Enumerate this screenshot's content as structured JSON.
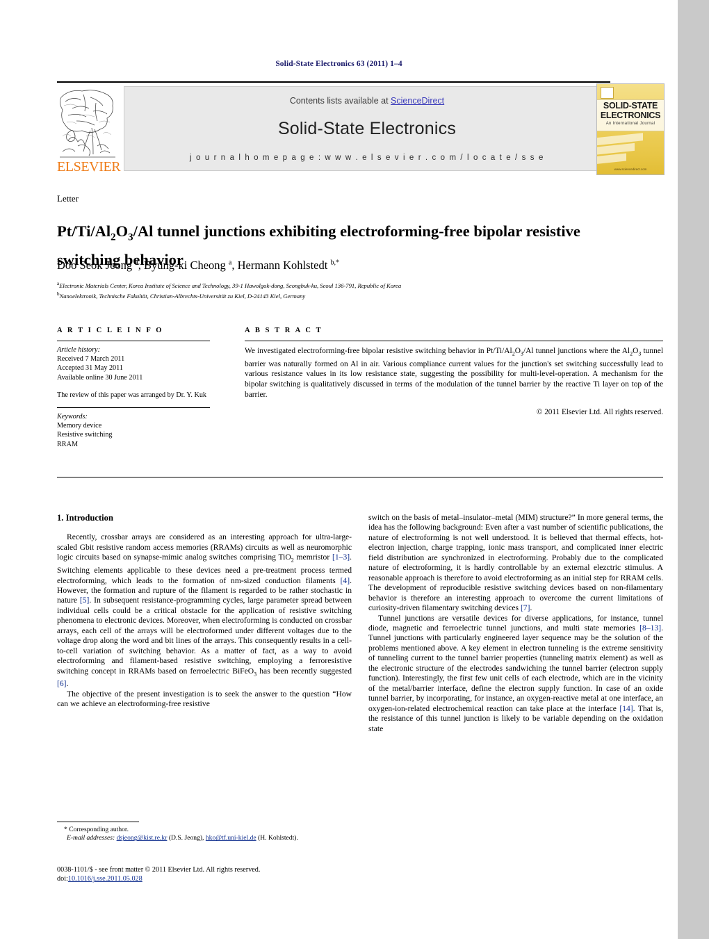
{
  "running_head": "Solid-State Electronics 63 (2011) 1–4",
  "masthead": {
    "contents_prefix": "Contents lists available at ",
    "sciencedirect": "ScienceDirect",
    "journal_name": "Solid-State Electronics",
    "homepage": "j o u r n a l   h o m e p a g e :   w w w . e l s e v i e r . c o m / l o c a t e / s s e",
    "publisher_logo_text": "ELSEVIER",
    "publisher_logo_icon": "elsevier-tree-icon"
  },
  "cover": {
    "title_line1": "SOLID-STATE",
    "title_line2": "ELECTRONICS",
    "subtitle": "An International Journal",
    "footer": "Available online at\nScienceDirect\nwww.sciencedirect.com"
  },
  "article": {
    "type_label": "Letter",
    "title_html": "Pt/Ti/Al<sub>2</sub>O<sub>3</sub>/Al tunnel junctions exhibiting electroforming-free bipolar resistive switching behavior",
    "authors_html": "Doo Seok Jeong <sup>a</sup>, Byung-ki Cheong <sup>a</sup>, Hermann Kohlstedt <sup>b,</sup><sup>*</sup>",
    "affiliations": [
      "Electronic Materials Center, Korea Institute of Science and Technology, 39-1 Hawolgok-dong, Seongbuk-ku, Seoul 136-791, Republic of Korea",
      "Nanoelektronik, Technische Fakultät, Christian-Albrechts-Universität zu Kiel, D-24143 Kiel, Germany"
    ],
    "affiliation_marks": [
      "a",
      "b"
    ]
  },
  "article_info": {
    "heading": "A R T I C L E  I N F O",
    "history_label": "Article history:",
    "history": [
      "Received 7 March 2011",
      "Accepted 31 May 2011",
      "Available online 30 June 2011"
    ],
    "review_note": "The review of this paper was arranged by Dr. Y. Kuk",
    "keywords_label": "Keywords:",
    "keywords": [
      "Memory device",
      "Resistive switching",
      "RRAM"
    ]
  },
  "abstract": {
    "heading": "A B S T R A C T",
    "text_html": "We investigated electroforming-free bipolar resistive switching behavior in Pt/Ti/Al<sub>2</sub>O<sub>3</sub>/Al tunnel junctions where the Al<sub>2</sub>O<sub>3</sub> tunnel barrier was naturally formed on Al in air. Various compliance current values for the junction's set switching successfully lead to various resistance values in its low resistance state, suggesting the possibility for multi-level-operation. A mechanism for the bipolar switching is qualitatively discussed in terms of the modulation of the tunnel barrier by the reactive Ti layer on top of the barrier.",
    "copyright": "© 2011 Elsevier Ltd. All rights reserved."
  },
  "body": {
    "section1_heading": "1. Introduction",
    "left_paragraphs": [
      "Recently, crossbar arrays are considered as an interesting approach for ultra-large-scaled Gbit resistive random access memories (RRAMs) circuits as well as neuromorphic logic circuits based on synapse-mimic analog switches comprising TiO<sub>2</sub> memristor <span class=\"cit\">[1–3]</span>. Switching elements applicable to these devices need a pre-treatment process termed electroforming, which leads to the formation of nm-sized conduction filaments <span class=\"cit\">[4]</span>. However, the formation and rupture of the filament is regarded to be rather stochastic in nature <span class=\"cit\">[5]</span>. In subsequent resistance-programming cycles, large parameter spread between individual cells could be a critical obstacle for the application of resistive switching phenomena to electronic devices. Moreover, when electroforming is conducted on crossbar arrays, each cell of the arrays will be electroformed under different voltages due to the voltage drop along the word and bit lines of the arrays. This consequently results in a cell-to-cell variation of switching behavior. As a matter of fact, as a way to avoid electroforming and filament-based resistive switching, employing a ferroresistive switching concept in RRAMs based on ferroelectric BiFeO<sub>3</sub> has been recently suggested <span class=\"cit\">[6]</span>.",
      "The objective of the present investigation is to seek the answer to the question “How can we achieve an electroforming-free resistive"
    ],
    "right_paragraphs": [
      "switch on the basis of metal–insulator–metal (MIM) structure?” In more general terms, the idea has the following background: Even after a vast number of scientific publications, the nature of electroforming is not well understood. It is believed that thermal effects, hot-electron injection, charge trapping, ionic mass transport, and complicated inner electric field distribution are synchronized in electroforming. Probably due to the complicated nature of electroforming, it is hardly controllable by an external elezctric stimulus. A reasonable approach is therefore to avoid electroforming as an initial step for RRAM cells. The development of reproducible resistive switching devices based on non-filamentary behavior is therefore an interesting approach to overcome the current limitations of curiosity-driven filamentary switching devices <span class=\"cit\">[7]</span>.",
      "Tunnel junctions are versatile devices for diverse applications, for instance, tunnel diode, magnetic and ferroelectric tunnel junctions, and multi state memories <span class=\"cit\">[8–13]</span>. Tunnel junctions with particularly engineered layer sequence may be the solution of the problems mentioned above. A key element in electron tunneling is the extreme sensitivity of tunneling current to the tunnel barrier properties (tunneling matrix element) as well as the electronic structure of the electrodes sandwiching the tunnel barrier (electron supply function). Interestingly, the first few unit cells of each electrode, which are in the vicinity of the metal/barrier interface, define the electron supply function. In case of an oxide tunnel barrier, by incorporating, for instance, an oxygen-reactive metal at one interface, an oxygen-ion-related electrochemical reaction can take place at the interface <span class=\"cit\">[14]</span>. That is, the resistance of this tunnel junction is likely to be variable depending on the oxidation state"
    ]
  },
  "footnotes": {
    "corresponding": "* Corresponding author.",
    "email_label": "E-mail addresses:",
    "email1": "dsjeong@kist.re.kr",
    "email1_owner": "(D.S. Jeong),",
    "email2": "hko@tf.uni-kiel.de",
    "email2_owner": "(H. Kohlstedt).",
    "frontmatter": "0038-1101/$ - see front matter © 2011 Elsevier Ltd. All rights reserved.",
    "doi_label": "doi:",
    "doi_value": "10.1016/j.sse.2011.05.028"
  },
  "colors": {
    "running_head": "#1b1b6b",
    "link": "#12308f",
    "sciencedirect": "#3b3bbb",
    "elsevier_orange": "#ef7d1a",
    "banner_bg": "#e9e9e9",
    "page_bg": "#ffffff",
    "gutter_bg": "#c9c9c9"
  }
}
